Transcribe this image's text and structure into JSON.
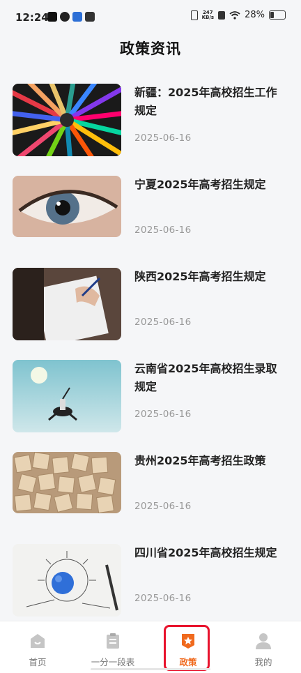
{
  "status_bar": {
    "time": "12:24",
    "net_speed_value": "247",
    "net_speed_unit": "KB/s",
    "battery_percent": "28%"
  },
  "header": {
    "title": "政策资讯"
  },
  "articles": [
    {
      "title": "新疆：2025年高校招生工作规定",
      "date": "2025-06-16",
      "image": "colored-pencils"
    },
    {
      "title": "宁夏2025年高考招生规定",
      "date": "2025-06-16",
      "image": "eye-closeup"
    },
    {
      "title": "陕西2025年高考招生规定",
      "date": "2025-06-16",
      "image": "hand-writing"
    },
    {
      "title": "云南省2025年高校招生录取规定",
      "date": "2025-06-16",
      "image": "jumping-person"
    },
    {
      "title": "贵州2025年高考招生政策",
      "date": "2025-06-16",
      "image": "letter-tiles"
    },
    {
      "title": "四川省2025年高校招生规定",
      "date": "2025-06-16",
      "image": "sketch-lightbulb"
    }
  ],
  "bottom_nav": {
    "items": [
      {
        "label": "首页",
        "icon": "home-icon"
      },
      {
        "label": "一分一段表",
        "icon": "clipboard-icon"
      },
      {
        "label": "政策",
        "icon": "star-badge-icon",
        "active": true
      },
      {
        "label": "我的",
        "icon": "user-icon"
      }
    ]
  },
  "colors": {
    "accent": "#f06a1e",
    "highlight": "#e8132d"
  }
}
